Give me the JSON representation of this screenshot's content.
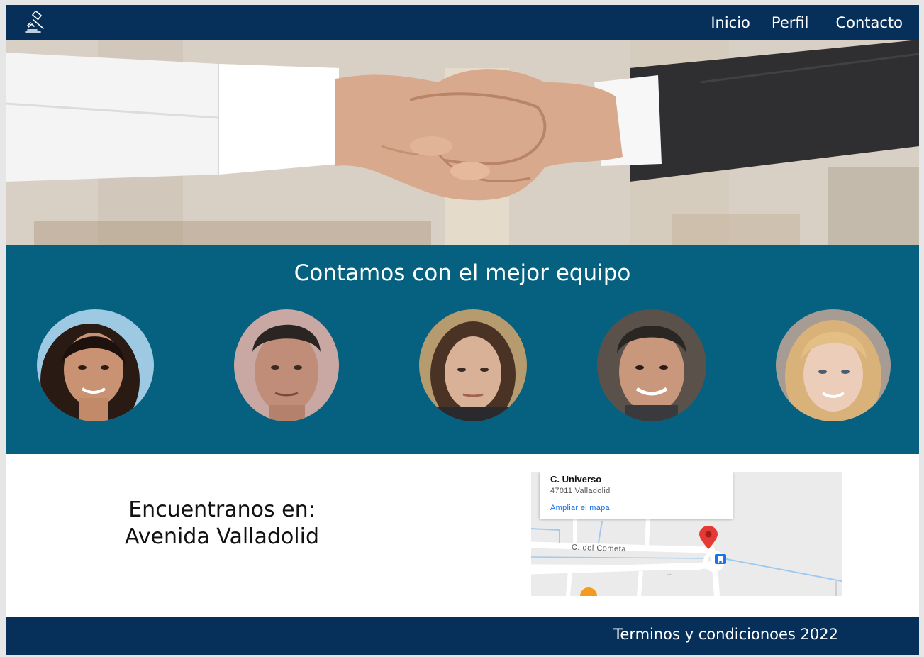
{
  "nav": {
    "logo_icon": "gavel-icon",
    "links": [
      {
        "label": "Inicio"
      },
      {
        "label": "Perfil"
      },
      {
        "label": "Contacto"
      }
    ]
  },
  "hero": {
    "image": "handshake-photo"
  },
  "team": {
    "title": "Contamos con el mejor equipo",
    "members": [
      {
        "photo": "team-member-1-photo"
      },
      {
        "photo": "team-member-2-photo"
      },
      {
        "photo": "team-member-3-photo"
      },
      {
        "photo": "team-member-4-photo"
      },
      {
        "photo": "team-member-5-photo"
      }
    ]
  },
  "location": {
    "line1": "Encuentranos en:",
    "line2": "Avenida Valladolid",
    "map": {
      "place_name": "C. Universo",
      "address": "47011 Valladolid",
      "expand_link": "Ampliar el mapa",
      "street": "C. del Cometa",
      "marker_icon": "map-pin-icon",
      "bus_icon": "bus-stop-icon"
    }
  },
  "footer": {
    "terms": "Terminos y condicionoes 2022"
  },
  "colors": {
    "nav_bg": "#06305a",
    "team_bg": "#05617f",
    "footer_bg": "#06305a",
    "map_link": "#1a73e8",
    "map_pin": "#e53935"
  }
}
